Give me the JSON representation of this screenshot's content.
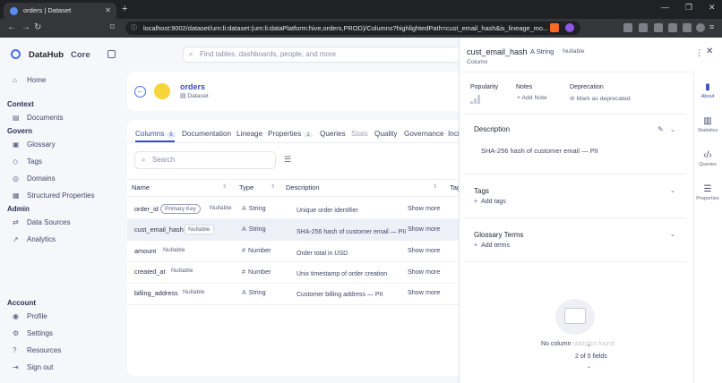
{
  "browser": {
    "tab_title": "orders | Dataset",
    "url": "localhost:9002/dataset/urn:li:dataset:(urn:li:dataPlatform:hive,orders,PROD)/Columns?highlightedPath=cust_email_hash&is_lineage_mo..."
  },
  "app": {
    "brand": "DataHub",
    "edition": "Core"
  },
  "sidebar": {
    "home": "Home",
    "context_head": "Context",
    "documents": "Documents",
    "govern_head": "Govern",
    "glossary": "Glossary",
    "tags": "Tags",
    "domains": "Domains",
    "structured_properties": "Structured Properties",
    "admin_head": "Admin",
    "data_sources": "Data Sources",
    "analytics": "Analytics",
    "account_head": "Account",
    "profile": "Profile",
    "settings": "Settings",
    "resources": "Resources",
    "sign_out": "Sign out"
  },
  "search": {
    "placeholder": "Find tables, dashboards, people, and more"
  },
  "entity": {
    "name": "orders",
    "type": "Dataset"
  },
  "tabs": [
    {
      "label": "Columns",
      "count": "5"
    },
    {
      "label": "Documentation"
    },
    {
      "label": "Lineage"
    },
    {
      "label": "Properties",
      "count": "1"
    },
    {
      "label": "Queries"
    },
    {
      "label": "Stats"
    },
    {
      "label": "Quality"
    },
    {
      "label": "Governance"
    },
    {
      "label": "Inci"
    }
  ],
  "table": {
    "search_placeholder": "Search",
    "headers": {
      "name": "Name",
      "type": "Type",
      "description": "Description",
      "tags": "Tag"
    },
    "show_more": "Show more",
    "rows": [
      {
        "name": "order_id",
        "badge": "Primary Key",
        "nullable": "Nullable",
        "type": "String",
        "type_icon": "A",
        "description": "Unique order identifier"
      },
      {
        "name": "cust_email_hash",
        "nullable": "Nullable",
        "type": "String",
        "type_icon": "A",
        "description": "SHA-256 hash of customer email — PII"
      },
      {
        "name": "amount",
        "nullable": "Nullable",
        "type": "Number",
        "type_icon": "#",
        "description": "Order total in USD"
      },
      {
        "name": "created_at",
        "nullable": "Nullable",
        "type": "Number",
        "type_icon": "#",
        "description": "Unix timestamp of order creation"
      },
      {
        "name": "billing_address",
        "nullable": "Nullable",
        "type": "String",
        "type_icon": "A",
        "description": "Customer billing address — PII"
      }
    ]
  },
  "drawer": {
    "title": "cust_email_hash",
    "type": "String",
    "nullable": "Nullable",
    "subtitle": "Column",
    "popularity": "Popularity",
    "notes": "Notes",
    "add_note": "+ Add Note",
    "deprecation": "Deprecation",
    "mark_deprecated": "Mark as deprecated",
    "description_head": "Description",
    "description": "SHA-256 hash of customer email — PII",
    "tags_head": "Tags",
    "add_tags": "Add tags",
    "terms_head": "Glossary Terms",
    "add_terms": "Add terms",
    "no_column": "No column",
    "no_column_faded": "statistics found",
    "pager": "2 of 5 fields"
  },
  "rail": {
    "about": "About",
    "statistics": "Statistics",
    "queries": "Queries",
    "properties": "Properties"
  },
  "colors": {
    "accent": "#3b4cc0",
    "brand": "#4a6cf7"
  }
}
